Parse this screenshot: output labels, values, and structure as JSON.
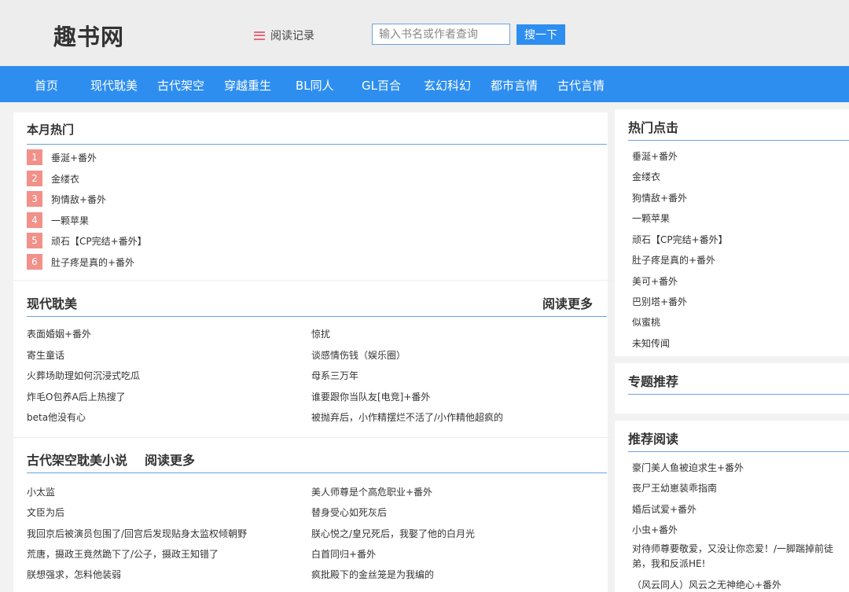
{
  "header": {
    "logo": "趣书网",
    "history_label": "阅读记录",
    "search_placeholder": "输入书名或作者查询",
    "search_button": "搜一下"
  },
  "nav": [
    "首页",
    "现代耽美",
    "古代架空",
    "穿越重生",
    "BL同人",
    "GL百合",
    "玄幻科幻",
    "都市言情",
    "古代言情"
  ],
  "monthly_hot": {
    "title": "本月热门",
    "items": [
      {
        "rank": "1",
        "title": "垂涎+番外"
      },
      {
        "rank": "2",
        "title": "金缕衣"
      },
      {
        "rank": "3",
        "title": "狗情敌+番外"
      },
      {
        "rank": "4",
        "title": "一颗苹果"
      },
      {
        "rank": "5",
        "title": "顽石【CP完结+番外】"
      },
      {
        "rank": "6",
        "title": "肚子疼是真的+番外"
      }
    ]
  },
  "modern": {
    "title": "现代耽美",
    "more": "阅读更多",
    "left": [
      "表面婚姻+番外",
      "寄生童话",
      "火葬场助理如何沉浸式吃瓜",
      "炸毛O包养A后上热搜了",
      "beta他没有心"
    ],
    "right": [
      "惊扰",
      "谈感情伤钱（娱乐圈）",
      "母系三万年",
      "谁要跟你当队友[电竞]+番外",
      "被抛弃后，小作精摆烂不活了/小作精他超疯的"
    ]
  },
  "ancient": {
    "title": "古代架空耽美小说",
    "more": "阅读更多",
    "left": [
      "小太监",
      "文臣为后",
      "我回京后被演员包围了/回宫后发现贴身太监权倾朝野",
      "荒唐，摄政王竟然跪下了/公子，摄政王知错了",
      "朕想强求，怎料他装弱"
    ],
    "right": [
      "美人师尊是个高危职业+番外",
      "替身受心如死灰后",
      "朕心悦之/皇兄死后，我娶了他的白月光",
      "白首同归+番外",
      "疯批殿下的金丝笼是为我编的"
    ]
  },
  "hot_clicks": {
    "title": "热门点击",
    "items": [
      "垂涎+番外",
      "金缕衣",
      "狗情敌+番外",
      "一颗苹果",
      "顽石【CP完结+番外】",
      "肚子疼是真的+番外",
      "美可+番外",
      "巴别塔+番外",
      "似蜜桃",
      "未知传闻"
    ]
  },
  "topics": {
    "title": "专题推荐"
  },
  "recommend": {
    "title": "推荐阅读",
    "items": [
      "豪门美人鱼被迫求生+番外",
      "丧尸王幼崽装乖指南",
      "婚后试爱+番外",
      "小虫+番外",
      "对待师尊要敬爱，又没让你恋爱！/一脚踹掉前徒弟，我和反派HE!",
      "（风云同人）风云之无神绝心+番外"
    ]
  },
  "colors": {
    "accent": "#2d8ef0",
    "rank_badge": "#f2908a",
    "header_bg": "#ededed",
    "page_bg": "#f2f2f2"
  }
}
